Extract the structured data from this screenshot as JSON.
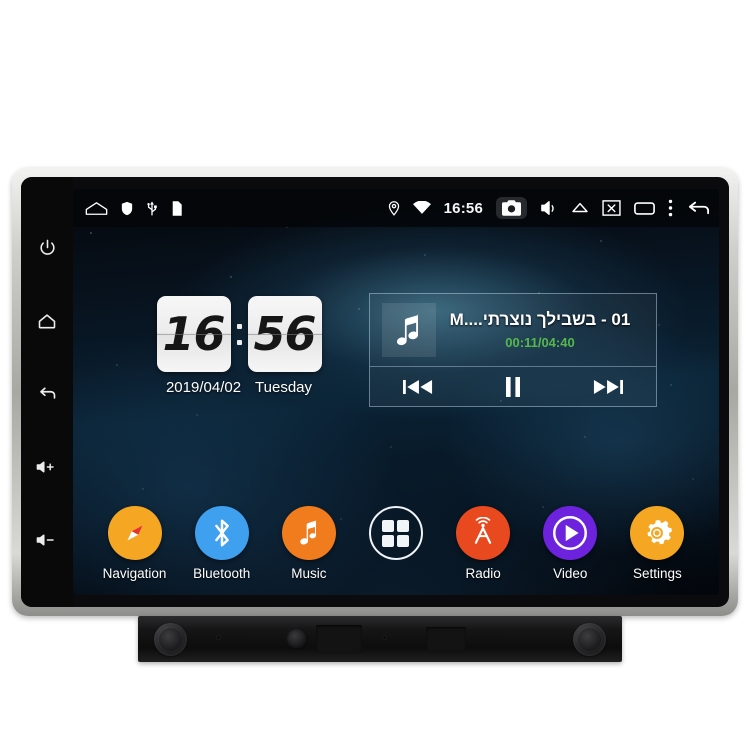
{
  "device": {
    "type": "android-car-head-unit",
    "bezel_color": "#c9c9c5"
  },
  "hardware_keys": [
    {
      "name": "power-key",
      "icon": "power-icon"
    },
    {
      "name": "home-key",
      "icon": "home-icon"
    },
    {
      "name": "back-key",
      "icon": "back-arrow-icon"
    },
    {
      "name": "volume-up-key",
      "icon": "volume-up-icon",
      "label": "+"
    },
    {
      "name": "volume-down-key",
      "icon": "volume-down-icon",
      "label": "-"
    }
  ],
  "statusbar": {
    "time": "16:56",
    "left_icons": [
      {
        "name": "home-indicator-icon",
        "icon": "house-outline"
      },
      {
        "name": "shield-icon",
        "icon": "shield"
      },
      {
        "name": "usb-icon",
        "icon": "usb"
      },
      {
        "name": "sd-card-icon",
        "icon": "sd-card"
      }
    ],
    "right_icons": [
      {
        "name": "location-icon",
        "icon": "map-pin"
      },
      {
        "name": "wifi-icon",
        "icon": "wifi"
      },
      {
        "name": "screenshot-icon",
        "icon": "camera"
      },
      {
        "name": "mute-icon",
        "icon": "speaker-mute"
      },
      {
        "name": "eject-icon",
        "icon": "eject-triangle"
      },
      {
        "name": "close-screen-icon",
        "icon": "screen-x"
      },
      {
        "name": "recents-icon",
        "icon": "rounded-rect"
      },
      {
        "name": "overflow-menu-icon",
        "icon": "three-dots-vertical"
      },
      {
        "name": "back-icon",
        "icon": "back-arrow"
      }
    ]
  },
  "clock_widget": {
    "hours": "16",
    "minutes": "56",
    "date": "2019/04/02",
    "weekday": "Tuesday"
  },
  "music_widget": {
    "album_art_icon": "music-note-icon",
    "track_title": "01 - בשבילך נוצרתי....M",
    "elapsed_total": "00:11/04:40",
    "elapsed": "00:11",
    "duration": "04:40",
    "time_color": "#55b84d",
    "controls": [
      {
        "name": "previous-track-button",
        "icon": "skip-previous-icon"
      },
      {
        "name": "pause-button",
        "icon": "pause-icon"
      },
      {
        "name": "next-track-button",
        "icon": "skip-next-icon"
      }
    ]
  },
  "dock": {
    "apps": [
      {
        "name": "navigation",
        "label": "Navigation",
        "icon": "compass-icon",
        "color": "#f5a623"
      },
      {
        "name": "bluetooth",
        "label": "Bluetooth",
        "icon": "bluetooth-icon",
        "color": "#3fa0ef"
      },
      {
        "name": "music",
        "label": "Music",
        "icon": "music-note-icon",
        "color": "#f07c1e"
      },
      {
        "name": "all-apps",
        "label": "",
        "icon": "apps-grid-icon",
        "color": "transparent"
      },
      {
        "name": "radio",
        "label": "Radio",
        "icon": "radio-tower-icon",
        "color": "#e8491f"
      },
      {
        "name": "video",
        "label": "Video",
        "icon": "play-circle-icon",
        "color": "#6d23dd"
      },
      {
        "name": "settings",
        "label": "Settings",
        "icon": "gear-icon",
        "color": "#f5a623"
      }
    ]
  }
}
